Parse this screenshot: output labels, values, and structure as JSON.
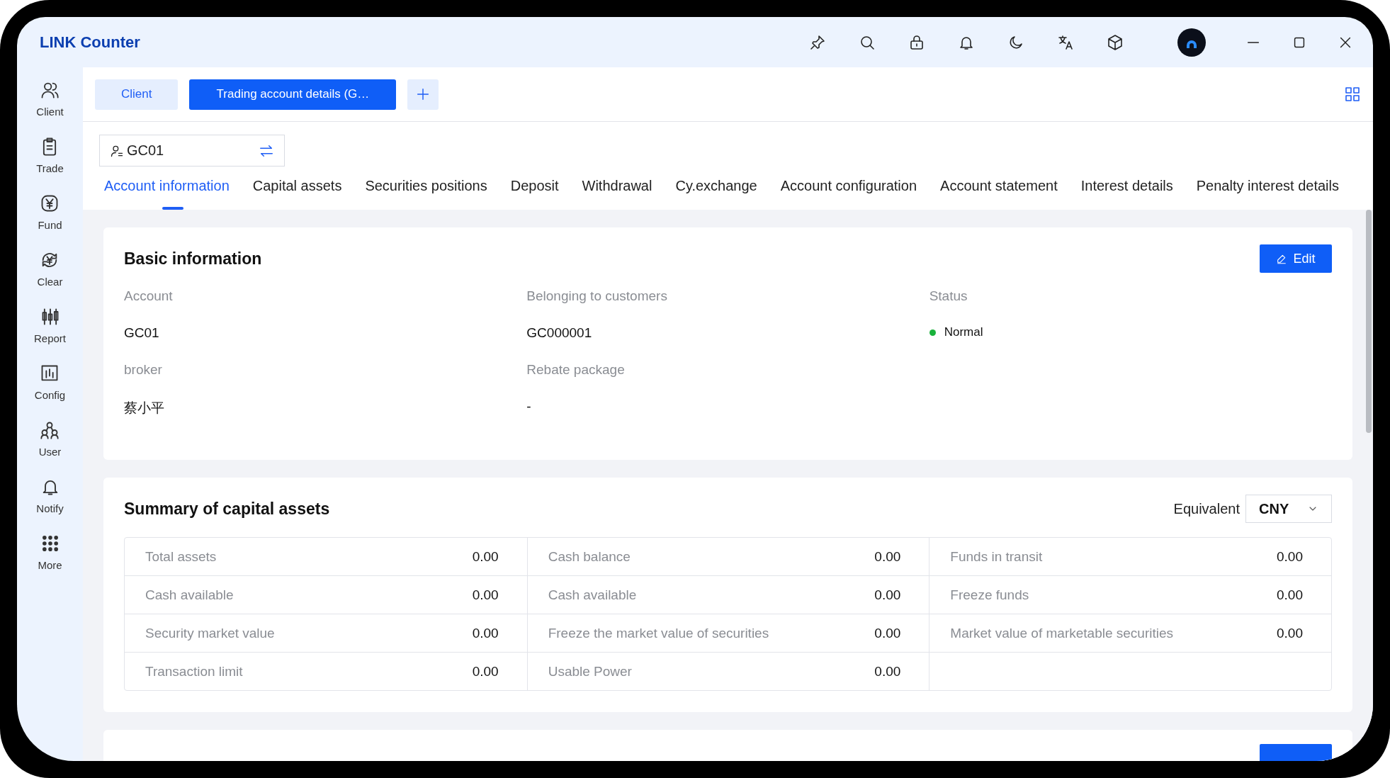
{
  "app": {
    "title": "LINK Counter"
  },
  "sidebar": {
    "items": [
      {
        "label": "Client"
      },
      {
        "label": "Trade"
      },
      {
        "label": "Fund"
      },
      {
        "label": "Clear"
      },
      {
        "label": "Report"
      },
      {
        "label": "Config"
      },
      {
        "label": "User"
      },
      {
        "label": "Notify"
      },
      {
        "label": "More"
      }
    ]
  },
  "page_tabs": [
    {
      "label": "Client",
      "selected": false
    },
    {
      "label": "Trading account details (G…",
      "selected": true
    }
  ],
  "account_selector": {
    "value": "GC01"
  },
  "section_tabs": [
    {
      "label": "Account information",
      "selected": true
    },
    {
      "label": "Capital assets",
      "selected": false
    },
    {
      "label": "Securities positions",
      "selected": false
    },
    {
      "label": "Deposit",
      "selected": false
    },
    {
      "label": "Withdrawal",
      "selected": false
    },
    {
      "label": "Cy.exchange",
      "selected": false
    },
    {
      "label": "Account configuration",
      "selected": false
    },
    {
      "label": "Account statement",
      "selected": false
    },
    {
      "label": "Interest details",
      "selected": false
    },
    {
      "label": "Penalty interest details",
      "selected": false
    }
  ],
  "basic_information": {
    "title": "Basic information",
    "button": "Edit",
    "fields": [
      {
        "kind": "text",
        "label": "Account",
        "value": "GC01"
      },
      {
        "kind": "text",
        "label": "Belonging to customers",
        "value": "GC000001"
      },
      {
        "kind": "status",
        "label": "Status",
        "value": "Normal",
        "color": "#19b23b"
      },
      {
        "kind": "text",
        "label": "broker",
        "value": "蔡小平"
      },
      {
        "kind": "text",
        "label": "Rebate package",
        "value": "-"
      }
    ]
  },
  "capital_summary": {
    "title": "Summary of capital assets",
    "equivalent_label": "Equivalent",
    "currency": "CNY",
    "rows": [
      [
        {
          "label": "Total assets",
          "value": "0.00"
        },
        {
          "label": "Cash balance",
          "value": "0.00"
        },
        {
          "label": "Funds in transit",
          "value": "0.00"
        }
      ],
      [
        {
          "label": "Cash available",
          "value": "0.00"
        },
        {
          "label": "Cash available",
          "value": "0.00"
        },
        {
          "label": "Freeze funds",
          "value": "0.00"
        }
      ],
      [
        {
          "label": "Security market value",
          "value": "0.00"
        },
        {
          "label": "Freeze the market value of securities",
          "value": "0.00"
        },
        {
          "label": "Market value of marketable securities",
          "value": "0.00"
        }
      ],
      [
        {
          "label": "Transaction limit",
          "value": "0.00"
        },
        {
          "label": "Usable Power",
          "value": "0.00"
        }
      ]
    ]
  }
}
